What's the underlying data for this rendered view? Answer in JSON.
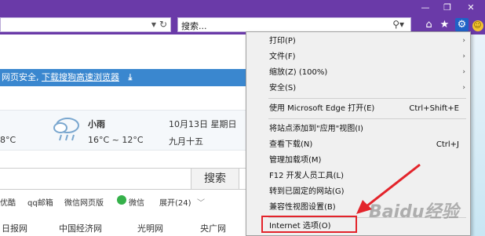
{
  "search": {
    "placeholder": "搜索..."
  },
  "window": {
    "restore_icon": "❐",
    "close_icon": "✕"
  },
  "page": {
    "banner_text": "网页安全,",
    "banner_link": "下载搜狗高速浏览器",
    "weather": {
      "left_temp": "8°C",
      "condition": "小雨",
      "range": "16°C ~ 12°C",
      "date": "10月13日 星期日",
      "lunar": "九月十五"
    },
    "search_button": "搜索",
    "links": [
      "优酷",
      "qq邮箱",
      "微信网页版",
      "微信",
      "展开(24)"
    ],
    "sites": [
      "日报网",
      "中国经济网",
      "光明网",
      "央广网"
    ]
  },
  "menu": {
    "items": [
      {
        "label": "打印(P)",
        "shortcut": "",
        "submenu": true
      },
      {
        "label": "文件(F)",
        "shortcut": "",
        "submenu": true
      },
      {
        "label": "缩放(Z) (100%)",
        "shortcut": "",
        "submenu": true
      },
      {
        "label": "安全(S)",
        "shortcut": "",
        "submenu": true
      },
      {
        "label": "使用 Microsoft Edge 打开(E)",
        "shortcut": "Ctrl+Shift+E",
        "submenu": false
      },
      {
        "label": "将站点添加到\"应用\"视图(I)",
        "shortcut": "",
        "submenu": false
      },
      {
        "label": "查看下载(N)",
        "shortcut": "Ctrl+J",
        "submenu": false
      },
      {
        "label": "管理加载项(M)",
        "shortcut": "",
        "submenu": false
      },
      {
        "label": "F12 开发人员工具(L)",
        "shortcut": "",
        "submenu": false
      },
      {
        "label": "转到已固定的网站(G)",
        "shortcut": "",
        "submenu": false
      },
      {
        "label": "兼容性视图设置(B)",
        "shortcut": "",
        "submenu": false
      },
      {
        "label": "Internet 选项(O)",
        "shortcut": "",
        "submenu": false
      }
    ]
  },
  "watermark": "Baidu经验",
  "colors": {
    "chrome": "#6a3aa8",
    "banner": "#3a87cf",
    "highlight": "#e3242b"
  }
}
